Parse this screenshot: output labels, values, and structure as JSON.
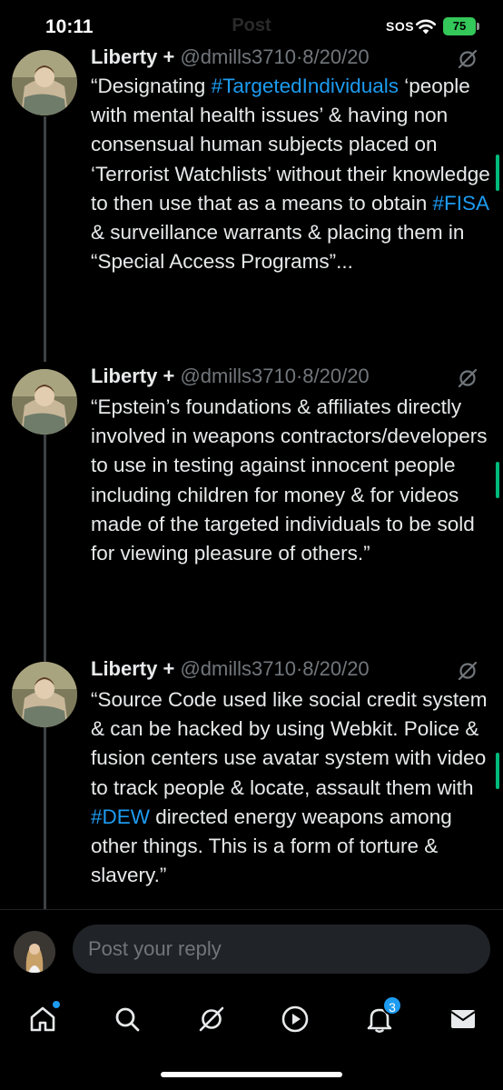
{
  "status_bar": {
    "time": "10:11",
    "header_title": "Post",
    "carrier": "SOS",
    "battery": "75"
  },
  "tweets": [
    {
      "author": "Liberty +",
      "handle": "@dmills3710",
      "separator": "·",
      "date": "8/20/20",
      "text_segments": [
        {
          "t": "“Designating ",
          "tag": false
        },
        {
          "t": "#TargetedIndividuals",
          "tag": true
        },
        {
          "t": " ‘people with mental health issues’ & having non consensual human subjects placed on ‘Terrorist Watchlists’ without their knowledge to then use that as a means to obtain ",
          "tag": false
        },
        {
          "t": "#FISA",
          "tag": true
        },
        {
          "t": " & surveillance warrants & placing them in “Special Access Programs”...",
          "tag": false
        }
      ]
    },
    {
      "author": "Liberty +",
      "handle": "@dmills3710",
      "separator": "·",
      "date": "8/20/20",
      "text_segments": [
        {
          "t": "“Epstein’s foundations & affiliates directly involved in weapons contractors/developers to use in testing against innocent people including children for money & for videos made of the targeted individuals to be sold for viewing pleasure of others.”",
          "tag": false
        }
      ]
    },
    {
      "author": "Liberty +",
      "handle": "@dmills3710",
      "separator": "·",
      "date": "8/20/20",
      "text_segments": [
        {
          "t": "“Source Code used like social credit system & can be hacked by using Webkit. Police & fusion centers use avatar system with video to track people & locate, assault them with ",
          "tag": false
        },
        {
          "t": "#DEW",
          "tag": true
        },
        {
          "t": " directed energy weapons among other things. This is a form of torture & slavery.”",
          "tag": false
        }
      ]
    }
  ],
  "reply": {
    "placeholder": "Post your reply"
  },
  "nav": {
    "items": [
      "home-icon",
      "search-icon",
      "grok-icon",
      "video-icon",
      "notifications-icon",
      "messages-icon"
    ],
    "notification_count": "3"
  },
  "colors": {
    "background": "#000000",
    "text": "#e7e9ea",
    "muted": "#71767b",
    "link": "#1d9bf0",
    "battery": "#34c759",
    "scroll_accent": "#00ba7c"
  }
}
